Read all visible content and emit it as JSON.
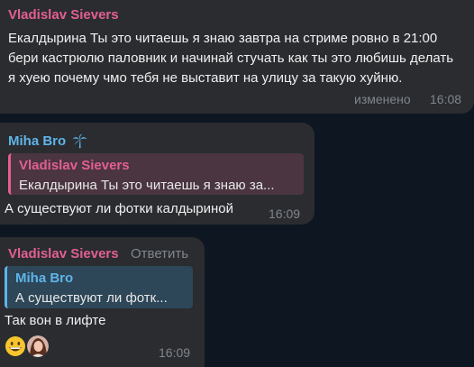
{
  "messages": [
    {
      "sender": "Vladislav Sievers",
      "text": "Екалдырина Ты это читаешь я знаю завтра на стриме ровно в 21:00 бери кастрюлю паловник и начинай стучать как ты это любишь делать я хуею почему чмо тебя не выставит на улицу за такую хуйню.",
      "status": "изменено",
      "time": "16:08"
    },
    {
      "sender": "Miha Bro",
      "reply_to": {
        "sender": "Vladislav Sievers",
        "text": "Екалдырина Ты это читаешь я знаю за..."
      },
      "text": "А существуют ли фотки калдыриной",
      "time": "16:09"
    },
    {
      "sender": "Vladislav Sievers",
      "reply_action": "Ответить",
      "reply_to": {
        "sender": "Miha Bro",
        "text": "А существуют ли фотк..."
      },
      "text": "Так вон в лифте",
      "reactions": [
        "grinning-face",
        "user-avatar"
      ],
      "time": "16:09"
    }
  ],
  "colors": {
    "background": "#0e1621",
    "bubble": "#2a2c30",
    "vladislav": "#e35f93",
    "miha": "#5fb4e8",
    "meta": "#80868d"
  },
  "icons": {
    "sender_badge": "palm-tree-icon"
  }
}
